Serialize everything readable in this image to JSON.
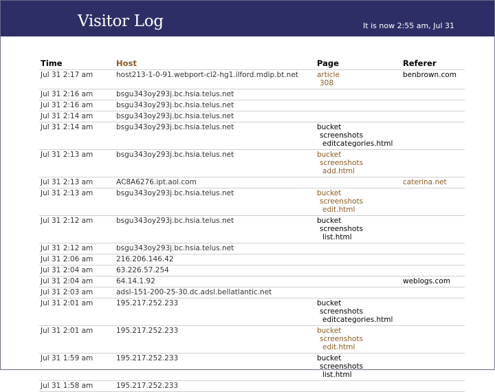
{
  "header": {
    "title": "Visitor Log",
    "clock": "It is now 2:55 am, Jul 31"
  },
  "colors": {
    "header_bg": "#2e2e66",
    "link": "#8b5a1e",
    "row_border": "#cfcfcf"
  },
  "columns": {
    "time": "Time",
    "host": "Host",
    "page": "Page",
    "referer": "Referer"
  },
  "rows": [
    {
      "time": "Jul 31 2:17 am",
      "host": "host213-1-0-91.webport-cl2-hg1.ilford.mdip.bt.net",
      "page": [
        "article",
        "308"
      ],
      "page_link": true,
      "referer": "benbrown.com",
      "referer_link": false
    },
    {
      "time": "Jul 31 2:16 am",
      "host": "bsgu343oy293j.bc.hsia.telus.net",
      "page": [],
      "page_link": false,
      "referer": "",
      "referer_link": false
    },
    {
      "time": "Jul 31 2:16 am",
      "host": "bsgu343oy293j.bc.hsia.telus.net",
      "page": [],
      "page_link": false,
      "referer": "",
      "referer_link": false
    },
    {
      "time": "Jul 31 2:14 am",
      "host": "bsgu343oy293j.bc.hsia.telus.net",
      "page": [],
      "page_link": false,
      "referer": "",
      "referer_link": false
    },
    {
      "time": "Jul 31 2:14 am",
      "host": "bsgu343oy293j.bc.hsia.telus.net",
      "page": [
        "bucket",
        "screenshots",
        "editcategories.html"
      ],
      "page_link": false,
      "referer": "",
      "referer_link": false
    },
    {
      "time": "Jul 31 2:13 am",
      "host": "bsgu343oy293j.bc.hsia.telus.net",
      "page": [
        "bucket",
        "screenshots",
        "add.html"
      ],
      "page_link": true,
      "referer": "",
      "referer_link": false
    },
    {
      "time": "Jul 31 2:13 am",
      "host": "AC8A6276.ipt.aol.com",
      "page": [],
      "page_link": false,
      "referer": "caterina.net",
      "referer_link": true
    },
    {
      "time": "Jul 31 2:13 am",
      "host": "bsgu343oy293j.bc.hsia.telus.net",
      "page": [
        "bucket",
        "screenshots",
        "edit.html"
      ],
      "page_link": true,
      "referer": "",
      "referer_link": false
    },
    {
      "time": "Jul 31 2:12 am",
      "host": "bsgu343oy293j.bc.hsia.telus.net",
      "page": [
        "bucket",
        "screenshots",
        "list.html"
      ],
      "page_link": false,
      "referer": "",
      "referer_link": false
    },
    {
      "time": "Jul 31 2:12 am",
      "host": "bsgu343oy293j.bc.hsia.telus.net",
      "page": [],
      "page_link": false,
      "referer": "",
      "referer_link": false
    },
    {
      "time": "Jul 31 2:06 am",
      "host": "216.206.146.42",
      "page": [],
      "page_link": false,
      "referer": "",
      "referer_link": false
    },
    {
      "time": "Jul 31 2:04 am",
      "host": "63.226.57.254",
      "page": [],
      "page_link": false,
      "referer": "",
      "referer_link": false
    },
    {
      "time": "Jul 31 2:04 am",
      "host": "64.14.1.92",
      "page": [],
      "page_link": false,
      "referer": "weblogs.com",
      "referer_link": false
    },
    {
      "time": "Jul 31 2:03 am",
      "host": "adsl-151-200-25-30.dc.adsl.bellatlantic.net",
      "page": [],
      "page_link": false,
      "referer": "",
      "referer_link": false
    },
    {
      "time": "Jul 31 2:01 am",
      "host": "195.217.252.233",
      "page": [
        "bucket",
        "screenshots",
        "editcategories.html"
      ],
      "page_link": false,
      "referer": "",
      "referer_link": false
    },
    {
      "time": "Jul 31 2:01 am",
      "host": "195.217.252.233",
      "page": [
        "bucket",
        "screenshots",
        "edit.html"
      ],
      "page_link": true,
      "referer": "",
      "referer_link": false
    },
    {
      "time": "Jul 31 1:59 am",
      "host": "195.217.252.233",
      "page": [
        "bucket",
        "screenshots",
        "list.html"
      ],
      "page_link": false,
      "referer": "",
      "referer_link": false
    },
    {
      "time": "Jul 31 1:58 am",
      "host": "195.217.252.233",
      "page": [],
      "page_link": false,
      "referer": "",
      "referer_link": false
    }
  ]
}
